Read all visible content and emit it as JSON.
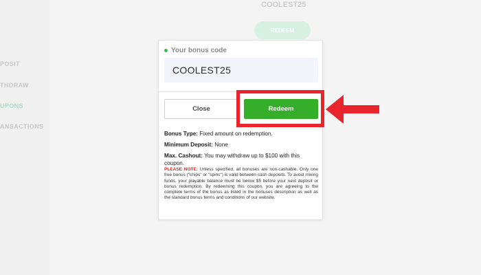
{
  "background": {
    "nav_items": [
      "POSIT",
      "THDRAW",
      "UPONS",
      "ANSACTIONS"
    ],
    "active_nav": "UPONS",
    "title": "COOLEST25",
    "pill_label": "REDEEM"
  },
  "modal": {
    "code_label": "Your bonus code",
    "code_value": "COOLEST25",
    "close_label": "Close",
    "redeem_label": "Redeem",
    "bonus_type_label": "Bonus Type:",
    "bonus_type_value": "Fixed amount on redemption.",
    "min_deposit_label": "Minimum Deposit:",
    "min_deposit_value": "None",
    "max_cashout_label": "Max. Cashout:",
    "max_cashout_value": "You may withdraw up to $100 with this coupon.",
    "note_label": "PLEASE NOTE:",
    "note_text": "Unless specified, all bonuses are non-cashable. Only one free bonus (\"chips\" or \"spins\") is valid between cash deposits. To avoid mixing funds, your playable balance must be below $5 before your next deposit or bonus redemption. By redeeming this coupon, you are agreeing to the complete terms of the bonus as listed in the bonuses description as well as the standard bonus terms and conditions of our website."
  },
  "colors": {
    "accent_green": "#35ae2a",
    "highlight_red": "#e8242d"
  }
}
